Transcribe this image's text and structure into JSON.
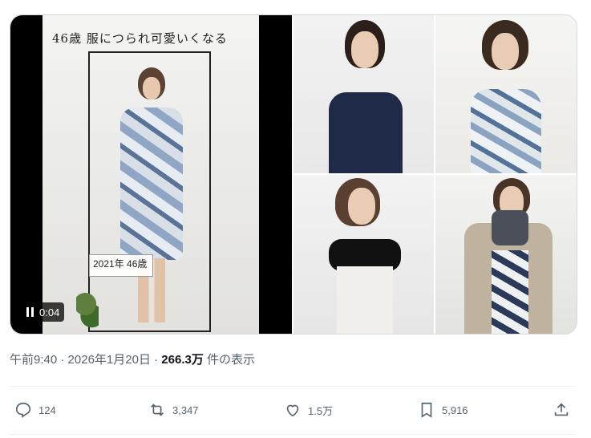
{
  "media": {
    "video_caption": "46歳 服につられ可愛いくなる",
    "video_badge": "2021年 46歳",
    "video_time": "0:04"
  },
  "meta": {
    "time": "午前9:40",
    "separator": " · ",
    "date": "2026年1月20日",
    "views": "266.3万",
    "views_suffix": " 件の表示"
  },
  "actions": {
    "reply_count": "124",
    "repost_count": "3,347",
    "like_count": "1.5万",
    "bookmark_count": "5,916"
  },
  "icons": {
    "reply": "reply-icon",
    "repost": "repost-icon",
    "like": "heart-icon",
    "bookmark": "bookmark-icon",
    "share": "share-icon",
    "pause": "pause-icon"
  },
  "colors": {
    "secondary_text": "#536471",
    "primary_text": "#0f1419",
    "border": "#cfd9de"
  }
}
